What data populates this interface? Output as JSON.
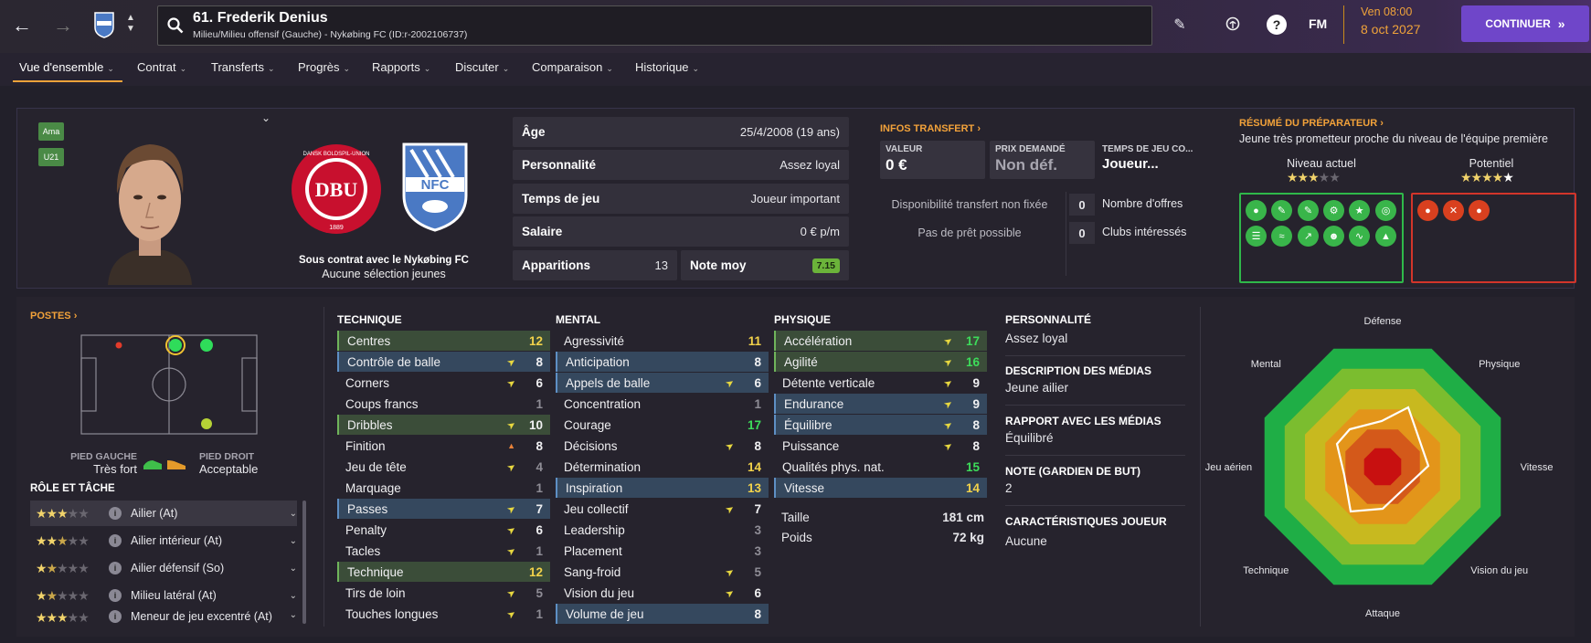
{
  "header": {
    "player_title": "61. Frederik Denius",
    "player_subtitle": "Milieu/Milieu offensif (Gauche) - Nykøbing FC (ID:r-2002106737)",
    "fm_label": "FM",
    "date_day": "Ven 08:00",
    "date_full": "8 oct 2027",
    "continue_label": "CONTINUER"
  },
  "nav": [
    {
      "label": "Vue d'ensemble"
    },
    {
      "label": "Contrat"
    },
    {
      "label": "Transferts"
    },
    {
      "label": "Progrès"
    },
    {
      "label": "Rapports"
    },
    {
      "label": "Discuter"
    },
    {
      "label": "Comparaison"
    },
    {
      "label": "Historique"
    }
  ],
  "profile": {
    "badges": [
      "Ama",
      "U21"
    ],
    "contract_line": "Sous contrat avec le Nykøbing FC",
    "youth_line": "Aucune sélection jeunes",
    "dbu_text": "DBU",
    "dbu_ring": "DANSK BOLDSPIL-UNION",
    "dbu_year": "1889",
    "club_text": "NFC"
  },
  "info": {
    "age_label": "Âge",
    "age_value": "25/4/2008 (19 ans)",
    "pers_label": "Personnalité",
    "pers_value": "Assez loyal",
    "time_label": "Temps de jeu",
    "time_value": "Joueur important",
    "salary_label": "Salaire",
    "salary_value": "0 € p/m",
    "apps_label": "Apparitions",
    "apps_value": "13",
    "rating_label": "Note moy",
    "rating_value": "7.15"
  },
  "transfer": {
    "heading": "INFOS TRANSFERT",
    "value_label": "VALEUR",
    "value_value": "0 €",
    "asking_label": "PRIX DEMANDÉ",
    "asking_value": "Non déf.",
    "playtime_label": "TEMPS DE JEU CO...",
    "playtime_value": "Joueur...",
    "availability": "Disponibilité transfert non fixée",
    "loan": "Pas de prêt possible",
    "offers_count": "0",
    "offers_label": "Nombre d'offres",
    "clubs_count": "0",
    "clubs_label": "Clubs intéressés"
  },
  "coach": {
    "heading": "RÉSUMÉ DU PRÉPARATEUR",
    "summary": "Jeune très prometteur proche du niveau de l'équipe première",
    "current_label": "Niveau actuel",
    "current_stars": 3,
    "potential_label": "Potentiel",
    "potential_stars": 4.5
  },
  "positions": {
    "heading": "POSTES",
    "left_foot_label": "PIED GAUCHE",
    "left_foot_value": "Très fort",
    "right_foot_label": "PIED DROIT",
    "right_foot_value": "Acceptable",
    "role_heading": "RÔLE ET TÂCHE",
    "roles": [
      {
        "name": "Ailier (At)",
        "stars": 3
      },
      {
        "name": "Ailier intérieur (At)",
        "stars": 2.5
      },
      {
        "name": "Ailier défensif (So)",
        "stars": 1.5
      },
      {
        "name": "Milieu latéral (At)",
        "stars": 1.5
      },
      {
        "name": "Meneur de jeu excentré (At)",
        "stars": 3
      }
    ]
  },
  "attributes": {
    "technique_heading": "TECHNIQUE",
    "mental_heading": "MENTAL",
    "physique_heading": "PHYSIQUE",
    "technique": [
      {
        "name": "Centres",
        "value": "12",
        "hl": "green",
        "arrow": ""
      },
      {
        "name": "Contrôle de balle",
        "value": "8",
        "hl": "blue",
        "arrow": "up"
      },
      {
        "name": "Corners",
        "value": "6",
        "hl": "",
        "arrow": "up"
      },
      {
        "name": "Coups francs",
        "value": "1",
        "hl": "",
        "arrow": ""
      },
      {
        "name": "Dribbles",
        "value": "10",
        "hl": "green",
        "arrow": "up"
      },
      {
        "name": "Finition",
        "value": "8",
        "hl": "",
        "arrow": "down"
      },
      {
        "name": "Jeu de tête",
        "value": "4",
        "hl": "",
        "arrow": "up"
      },
      {
        "name": "Marquage",
        "value": "1",
        "hl": "",
        "arrow": ""
      },
      {
        "name": "Passes",
        "value": "7",
        "hl": "blue",
        "arrow": "up"
      },
      {
        "name": "Penalty",
        "value": "6",
        "hl": "",
        "arrow": "up"
      },
      {
        "name": "Tacles",
        "value": "1",
        "hl": "",
        "arrow": "up"
      },
      {
        "name": "Technique",
        "value": "12",
        "hl": "green",
        "arrow": ""
      },
      {
        "name": "Tirs de loin",
        "value": "5",
        "hl": "",
        "arrow": "up"
      },
      {
        "name": "Touches longues",
        "value": "1",
        "hl": "",
        "arrow": "up"
      }
    ],
    "mental": [
      {
        "name": "Agressivité",
        "value": "11",
        "hl": "",
        "arrow": ""
      },
      {
        "name": "Anticipation",
        "value": "8",
        "hl": "blue",
        "arrow": ""
      },
      {
        "name": "Appels de balle",
        "value": "6",
        "hl": "blue",
        "arrow": "up"
      },
      {
        "name": "Concentration",
        "value": "1",
        "hl": "",
        "arrow": ""
      },
      {
        "name": "Courage",
        "value": "17",
        "hl": "",
        "arrow": ""
      },
      {
        "name": "Décisions",
        "value": "8",
        "hl": "",
        "arrow": "up"
      },
      {
        "name": "Détermination",
        "value": "14",
        "hl": "",
        "arrow": ""
      },
      {
        "name": "Inspiration",
        "value": "13",
        "hl": "blue",
        "arrow": ""
      },
      {
        "name": "Jeu collectif",
        "value": "7",
        "hl": "",
        "arrow": "up"
      },
      {
        "name": "Leadership",
        "value": "3",
        "hl": "",
        "arrow": ""
      },
      {
        "name": "Placement",
        "value": "3",
        "hl": "",
        "arrow": ""
      },
      {
        "name": "Sang-froid",
        "value": "5",
        "hl": "",
        "arrow": "up"
      },
      {
        "name": "Vision du jeu",
        "value": "6",
        "hl": "",
        "arrow": "up"
      },
      {
        "name": "Volume de jeu",
        "value": "8",
        "hl": "blue",
        "arrow": ""
      }
    ],
    "physique": [
      {
        "name": "Accélération",
        "value": "17",
        "hl": "green",
        "arrow": "up"
      },
      {
        "name": "Agilité",
        "value": "16",
        "hl": "green",
        "arrow": "up"
      },
      {
        "name": "Détente verticale",
        "value": "9",
        "hl": "",
        "arrow": "up"
      },
      {
        "name": "Endurance",
        "value": "9",
        "hl": "blue",
        "arrow": "up"
      },
      {
        "name": "Équilibre",
        "value": "8",
        "hl": "blue",
        "arrow": "up"
      },
      {
        "name": "Puissance",
        "value": "8",
        "hl": "",
        "arrow": "up"
      },
      {
        "name": "Qualités phys. nat.",
        "value": "15",
        "hl": "",
        "arrow": ""
      },
      {
        "name": "Vitesse",
        "value": "14",
        "hl": "blue",
        "arrow": ""
      }
    ],
    "height_label": "Taille",
    "height_value": "181 cm",
    "weight_label": "Poids",
    "weight_value": "72 kg"
  },
  "personality": {
    "pers_h": "PERSONNALITÉ",
    "pers_v": "Assez loyal",
    "media_desc_h": "DESCRIPTION DES MÉDIAS",
    "media_desc_v": "Jeune ailier",
    "media_rel_h": "RAPPORT AVEC LES MÉDIAS",
    "media_rel_v": "Équilibré",
    "gk_h": "NOTE (GARDIEN DE BUT)",
    "gk_v": "2",
    "traits_h": "CARACTÉRISTIQUES JOUEUR",
    "traits_v": "Aucune"
  },
  "radar": {
    "labels": [
      "Défense",
      "Physique",
      "Vitesse",
      "Vision du jeu",
      "Attaque",
      "Technique",
      "Jeu aérien",
      "Mental"
    ]
  },
  "colors": {
    "accent_purple": "#6f46c9",
    "orange": "#f2a23a",
    "green_value": "#3ddc5a",
    "yellow_value": "#f2d24a"
  }
}
